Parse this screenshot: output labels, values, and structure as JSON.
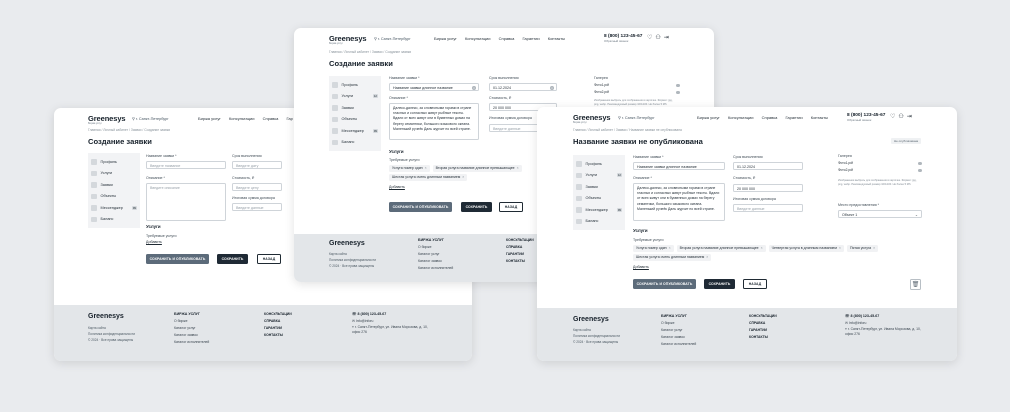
{
  "brand": {
    "name": "Greenesys",
    "tagline": "Биржа услуг",
    "city": "г. Санкт-Петербург"
  },
  "nav": [
    "Биржа услуг",
    "Консультации",
    "Справка",
    "Гарантии",
    "Контакты"
  ],
  "nav_short_left": [
    "Биржа услуг",
    "Консультации",
    "Справка",
    "Гар"
  ],
  "header": {
    "phone": "8 (800) 123-45-67",
    "callback": "Обратный звонок",
    "icons": [
      "heart-icon",
      "user-icon",
      "logout-icon"
    ]
  },
  "breadcrumbs": {
    "create": "Главная / Личный кабинет / Заявки / Создание заявки",
    "view": "Главная / Личный кабинет / Заявки / Название заявки не опубликована"
  },
  "sidebar": [
    {
      "label": "Профиль",
      "badge": ""
    },
    {
      "label": "Услуги",
      "badge": "12"
    },
    {
      "label": "Заявки",
      "badge": ""
    },
    {
      "label": "Объекты",
      "badge": ""
    },
    {
      "label": "Мессенджер",
      "badge": "99"
    },
    {
      "label": "Баланс",
      "badge": ""
    }
  ],
  "labels": {
    "name": "Название заявки *",
    "deadline": "Срок выполнения",
    "description": "Описание *",
    "cost": "Стоимость, ₽",
    "conditions": "Итоговая сумма договора",
    "gallery": "Галерея",
    "place": "Место предоставления *",
    "services": "Услуги",
    "required": "Требуемые услуги",
    "add": "Добавить"
  },
  "placeholders": {
    "name": "Введите название",
    "deadline": "Введите дату",
    "description": "Введите описание",
    "cost": "Введите цену",
    "conditions": "Введите данные"
  },
  "values": {
    "name": "Название заявки длинное название",
    "deadline": "01.12.2024",
    "cost": "20 000 000",
    "place": "Объект 1",
    "description": "Далеко-далеко, за словесными горами в стране гласных и согласных живут рыбные тексты. Вдали от всех живут они в буквенных домах на берегу семантики, большого языкового океана. Маленький ручеёк Даль журчит по всей стране."
  },
  "chips": [
    "Услуга номер один",
    "Вторая услуга название длинное превышающее",
    "Четвертая услуга в длинным названием",
    "Пятая услуга",
    "Шестая услуга очень длинным названием"
  ],
  "gallery": {
    "files": [
      "Фото1.pdf",
      "Фото2.pdf"
    ],
    "note": "Изображения выбрать для отображения в карточке. Формат: jpg, png, webp. Рекомендуемый размер 100х100. Не более 5 Мб."
  },
  "status": "Не опубликована",
  "title_create": "Создание заявки",
  "title_view": "Название заявки не опубликована",
  "buttons": {
    "publish": "СОХРАНИТЬ И ОПУБЛИКОВАТЬ",
    "save": "СОХРАНИТЬ",
    "back": "НАЗАД"
  },
  "footer": {
    "col1": [
      "Карта сайта",
      "Политика конфиденциальности",
      "© 2024 · Все права защищены"
    ],
    "col2_title": "БИРЖА УСЛУГ",
    "col2": [
      "О бирже",
      "Каталог услуг",
      "Каталог заявок",
      "Каталог исполнителей"
    ],
    "col3": [
      "КОНСУЛЬТАЦИИ",
      "СПРАВКА",
      "ГАРАНТИИ",
      "КОНТАКТЫ"
    ],
    "phone": "8 (800) 123-45-67",
    "email": "Info@inforu",
    "address": "г. Санкт-Петербург, ул. Ивана Морозова, д. 10, офис 276"
  }
}
